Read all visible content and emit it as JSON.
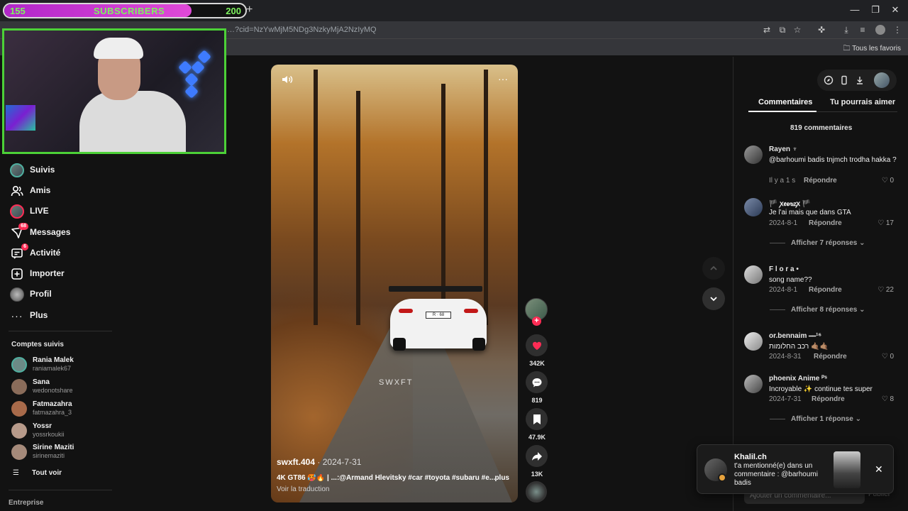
{
  "subscriber_goal": {
    "current": "155",
    "label": "SUBSCRIBERS",
    "target": "200",
    "progress": 0.775
  },
  "browser": {
    "url": "…?cid=NzYwMjM5NDg3NzkyMjA2NzIyMQ",
    "bookmarks_folder": "Tous les favoris"
  },
  "nav": {
    "items": [
      {
        "label": "Suivis",
        "icon": "following-avatar-icon"
      },
      {
        "label": "Amis",
        "icon": "friends-icon"
      },
      {
        "label": "LIVE",
        "icon": "live-icon"
      },
      {
        "label": "Messages",
        "icon": "messages-icon",
        "badge": "68"
      },
      {
        "label": "Activité",
        "icon": "activity-icon",
        "badge": "6"
      },
      {
        "label": "Importer",
        "icon": "upload-icon"
      },
      {
        "label": "Profil",
        "icon": "profile-icon"
      },
      {
        "label": "Plus",
        "icon": "more-icon"
      }
    ],
    "followed_title": "Comptes suivis",
    "accounts": [
      {
        "name": "Rania Malek",
        "handle": "raniamalek67",
        "color": "#6c8a86"
      },
      {
        "name": "Sana",
        "handle": "wedonotshare",
        "color": "#8a6c5a"
      },
      {
        "name": "Fatmazahra",
        "handle": "fatmazahra_3",
        "color": "#a86a4a"
      },
      {
        "name": "Yossr",
        "handle": "yossrkoukii",
        "color": "#b79a8a"
      },
      {
        "name": "Sirine Maziti",
        "handle": "sirinemaziti",
        "color": "#a58a7a"
      }
    ],
    "see_all": "Tout voir",
    "business": "Entreprise"
  },
  "video": {
    "author": "swxft.404",
    "date": "2024-7-31",
    "caption": "4K GT86 🥵🔥 | ...:@Armand Hlevitsky #car #toyota #subaru #e...",
    "more": "plus",
    "translate": "Voir la traduction",
    "watermark": "SWXFT",
    "plate": "R · 68"
  },
  "actions": {
    "likes": "342K",
    "comments": "819",
    "saves": "47.9K",
    "shares": "13K"
  },
  "panel": {
    "tab_comments": "Commentaires",
    "tab_suggest": "Tu pourrais aimer",
    "count": "819 commentaires",
    "comments": [
      {
        "user": "Rayen ♆",
        "text": "@barhoumi badis tnjmch trodha hakka ?",
        "meta": "Il y a 1 s",
        "reply": "Répondre",
        "likes": "0"
      },
      {
        "user": "🏴 ꭗꬲꭷꮏꮓꭗ 🏴",
        "text": "Je l'ai mais que dans GTA",
        "meta": "2024-8-1",
        "reply": "Répondre",
        "likes": "17",
        "more_replies": "Afficher 7 réponses"
      },
      {
        "user": "F l o r a •",
        "text": "song name??",
        "meta": "2024-8-1",
        "reply": "Répondre",
        "likes": "22",
        "more_replies": "Afficher 8 réponses"
      },
      {
        "user": "or.bennaim ⎯⎯¹⁶",
        "text": "רכב החלומות 🤙🏽🤙🏽",
        "meta": "2024-8-31",
        "reply": "Répondre",
        "likes": "0"
      },
      {
        "user": "phoenix Anime ᴾˢ",
        "text": "Incroyable ✨ continue tes super",
        "meta": "2024-7-31",
        "reply": "Répondre",
        "likes": "8",
        "more_replies": "Afficher 1 réponse"
      }
    ],
    "input_placeholder": "Ajouter un commentaire...",
    "post": "Publier"
  },
  "toast": {
    "name": "Khalil.ch",
    "text": "t'a mentionné(e) dans un commentaire : @barhoumi badis"
  },
  "colors": {
    "accent": "#fe2c55",
    "webcam_border": "#4cd137",
    "goal_fill": "#c63ad2"
  }
}
